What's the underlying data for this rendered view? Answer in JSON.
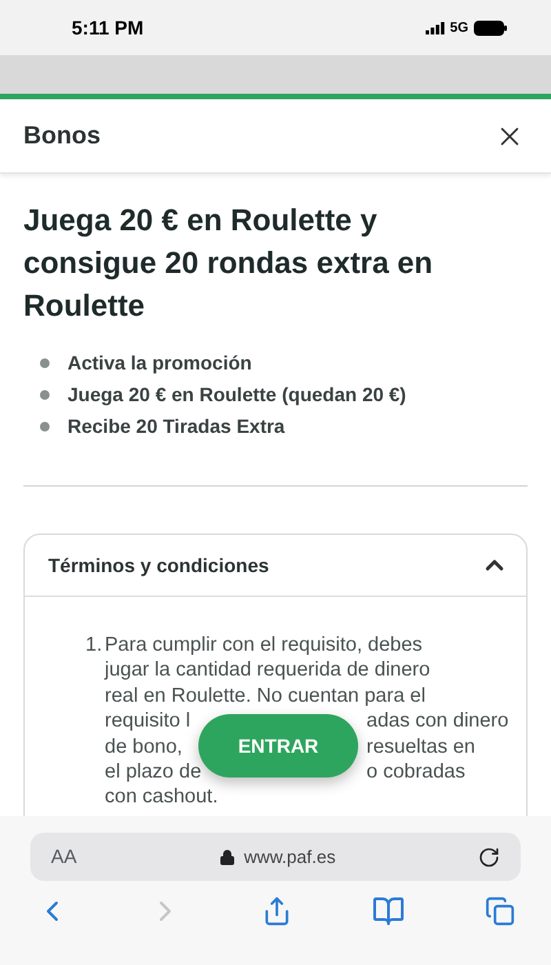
{
  "status_bar": {
    "time": "5:11 PM",
    "network": "5G"
  },
  "header": {
    "title": "Bonos"
  },
  "promo": {
    "title": "Juega 20 € en Roulette y consigue 20 rondas extra en Roulette",
    "steps": [
      "Activa la promoción",
      "Juega 20 € en Roulette (quedan 20 €)",
      "Recibe 20 Tiradas Extra"
    ]
  },
  "terms": {
    "title": "Términos y condiciones",
    "expanded": true,
    "items": [
      {
        "number": "1.",
        "lines": [
          {
            "segments": [
              "Para cumplir con el requisito, debes"
            ]
          },
          {
            "segments": [
              "jugar la cantidad requerida de dinero"
            ]
          },
          {
            "segments": [
              "real en Roulette. No cuentan para el"
            ]
          },
          {
            "segments": [
              "requisito l",
              "adas con dinero"
            ]
          },
          {
            "segments": [
              "de bono,",
              "resueltas en"
            ]
          },
          {
            "segments": [
              "el plazo de",
              "o cobradas"
            ]
          },
          {
            "segments": [
              "con cashout."
            ]
          }
        ]
      }
    ]
  },
  "cta": {
    "label": "ENTRAR"
  },
  "browser": {
    "text_size": "AA",
    "url": "www.paf.es",
    "forward_disabled": true
  }
}
